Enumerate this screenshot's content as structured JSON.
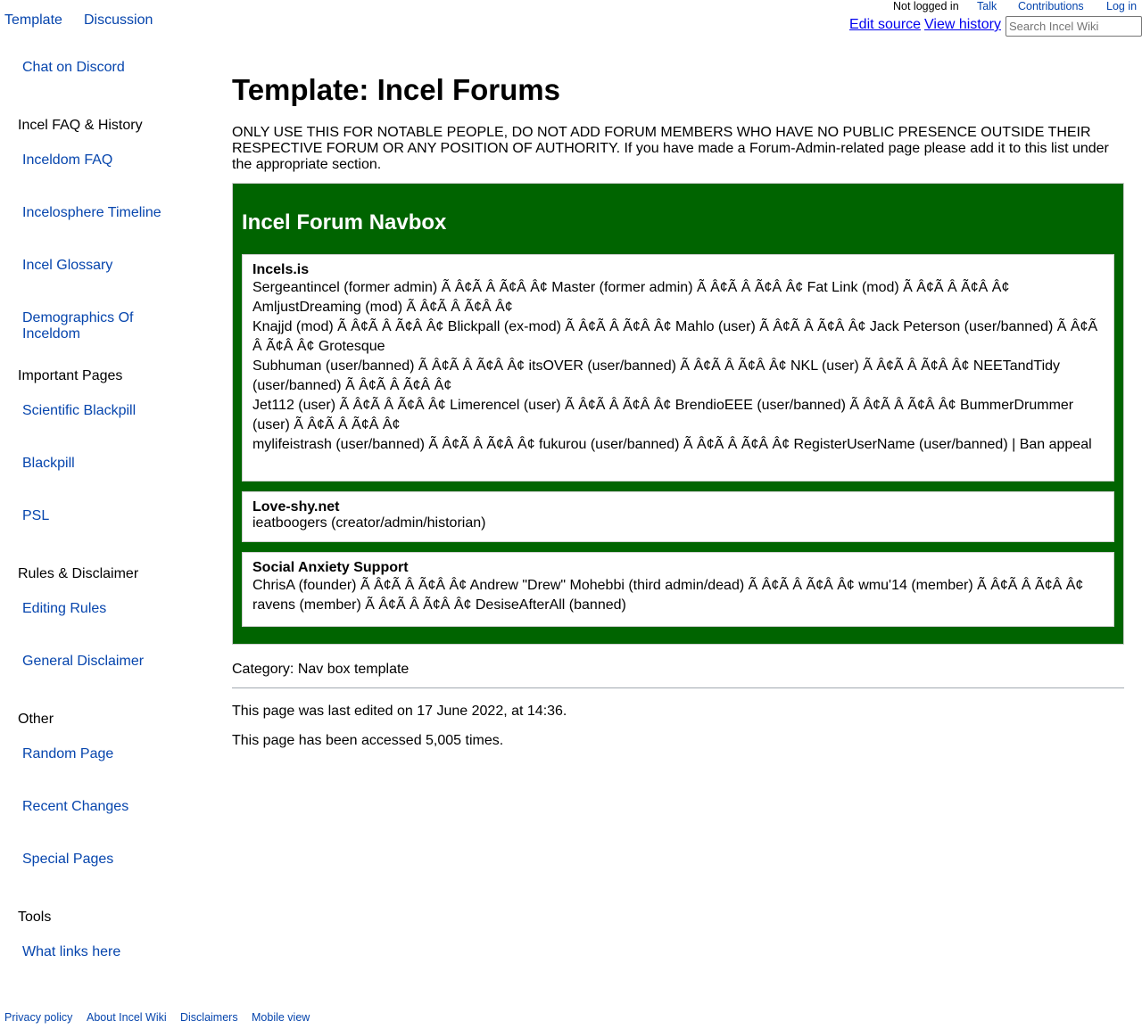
{
  "tabs": {
    "template": "Template",
    "discussion": "Discussion"
  },
  "personal": {
    "status": "Not logged in",
    "talk": "Talk",
    "contributions": "Contributions",
    "login": "Log in"
  },
  "views": {
    "edit_source": "Edit source",
    "view_history": "View history"
  },
  "search": {
    "placeholder": "Search Incel Wiki"
  },
  "sidebar": {
    "chat": "Chat on Discord",
    "faq_heading": "Incel FAQ & History",
    "faq_items": [
      "Inceldom FAQ",
      "Incelosphere Timeline",
      "Incel Glossary",
      "Demographics Of Inceldom"
    ],
    "important_heading": "Important Pages",
    "important_items": [
      "Scientific Blackpill",
      "Blackpill",
      "PSL"
    ],
    "rules_heading": "Rules & Disclaimer",
    "rules_items": [
      "Editing Rules",
      "General Disclaimer"
    ],
    "other_heading": "Other",
    "other_items": [
      "Random Page",
      "Recent Changes",
      "Special Pages"
    ],
    "tools_heading": "Tools",
    "tools_items": [
      "What links here"
    ]
  },
  "page": {
    "title": "Template: Incel Forums",
    "notice": "ONLY USE THIS FOR NOTABLE PEOPLE, DO NOT ADD FORUM MEMBERS WHO HAVE NO PUBLIC PRESENCE OUTSIDE THEIR RESPECTIVE FORUM OR ANY POSITION OF AUTHORITY. If you have made a Forum-Admin-related page please add it to this list under the appropriate section."
  },
  "navbox": {
    "title": "Incel Forum Navbox",
    "groups": [
      {
        "title": "Incels.is",
        "lines": [
          "Sergeantincel (former admin) Ã Â¢Ã Â Ã¢Â Â¢ Master (former admin) Ã Â¢Ã Â Ã¢Â Â¢ Fat Link (mod) Ã Â¢Ã Â Ã¢Â Â¢ AmljustDreaming (mod) Ã Â¢Ã Â Ã¢Â Â¢",
          "Knajjd (mod) Ã Â¢Ã Â Ã¢Â Â¢ Blickpall (ex-mod) Ã Â¢Ã Â Ã¢Â Â¢ Mahlo (user) Ã Â¢Ã Â Ã¢Â Â¢ Jack Peterson (user/banned) Ã Â¢Ã Â Ã¢Â Â¢ Grotesque",
          "Subhuman (user/banned) Ã Â¢Ã Â Ã¢Â Â¢ itsOVER (user/banned) Ã Â¢Ã Â Ã¢Â Â¢ NKL (user) Ã Â¢Ã Â Ã¢Â Â¢ NEETandTidy (user/banned) Ã Â¢Ã Â Ã¢Â Â¢",
          "Jet112 (user) Ã Â¢Ã Â Ã¢Â Â¢ Limerencel (user) Ã Â¢Ã Â Ã¢Â Â¢ BrendioEEE (user/banned) Ã Â¢Ã Â Ã¢Â Â¢ BummerDrummer (user) Ã Â¢Ã Â Ã¢Â Â¢",
          "mylifeistrash (user/banned) Ã Â¢Ã Â Ã¢Â Â¢ fukurou (user/banned) Ã Â¢Ã Â Ã¢Â Â¢ RegisterUserName (user/banned) | Ban appeal"
        ]
      },
      {
        "title": "Love-shy.net",
        "lines": [
          "ieatboogers (creator/admin/historian)"
        ]
      },
      {
        "title": "Social Anxiety Support",
        "lines": [
          "ChrisA (founder) Ã Â¢Ã Â Ã¢Â Â¢ Andrew \"Drew\" Mohebbi (third admin/dead) Ã Â¢Ã Â Ã¢Â Â¢ wmu'14 (member) Ã Â¢Ã Â Ã¢Â Â¢ ravens (member) Ã Â¢Ã Â Ã¢Â Â¢ DesiseAfterAll (banned)"
        ]
      }
    ]
  },
  "category": "Category: Nav box template",
  "footer": {
    "last_edited": "This page was last edited on 17 June 2022, at 14:36.",
    "accessed": "This page has been accessed 5,005 times.",
    "links": [
      "Privacy policy",
      "About Incel Wiki",
      "Disclaimers",
      "Mobile view"
    ]
  }
}
